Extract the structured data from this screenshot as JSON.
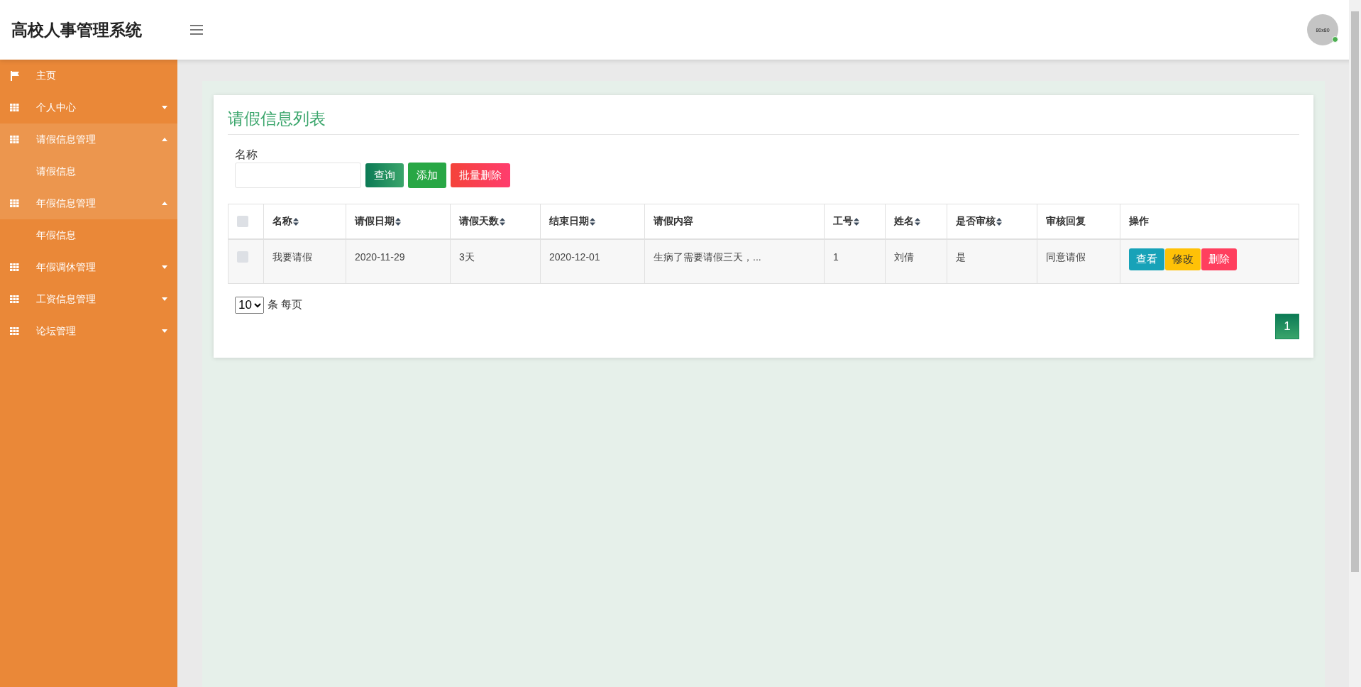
{
  "header": {
    "title": "高校人事管理系统",
    "avatar": "80x80"
  },
  "sidebar": {
    "items": [
      {
        "label": "主页",
        "kind": "link",
        "expanded": false
      },
      {
        "label": "个人中心",
        "kind": "group",
        "expanded": false
      },
      {
        "label": "请假信息管理",
        "kind": "group",
        "expanded": true,
        "children": [
          {
            "label": "请假信息",
            "selected": true
          }
        ]
      },
      {
        "label": "年假信息管理",
        "kind": "group",
        "expanded": true,
        "children": [
          {
            "label": "年假信息",
            "selected": false
          }
        ]
      },
      {
        "label": "年假调休管理",
        "kind": "group",
        "expanded": false
      },
      {
        "label": "工资信息管理",
        "kind": "group",
        "expanded": false
      },
      {
        "label": "论坛管理",
        "kind": "group",
        "expanded": false
      }
    ]
  },
  "card": {
    "title": "请假信息列表",
    "search": {
      "label": "名称"
    },
    "buttons": [
      {
        "label": "查询",
        "kind": "search"
      },
      {
        "label": "添加",
        "kind": "add"
      },
      {
        "label": "批量删除",
        "kind": "delete"
      }
    ],
    "table": {
      "select_all": {
        "checked": false
      },
      "columns": [
        {
          "label": "名称",
          "sortable": true
        },
        {
          "label": "请假日期",
          "sortable": true
        },
        {
          "label": "请假天数",
          "sortable": true
        },
        {
          "label": "结束日期",
          "sortable": true
        },
        {
          "label": "请假内容",
          "sortable": false
        },
        {
          "label": "工号",
          "sortable": true
        },
        {
          "label": "姓名",
          "sortable": true
        },
        {
          "label": "是否审核",
          "sortable": true
        },
        {
          "label": "审核回复",
          "sortable": false
        },
        {
          "label": "操作",
          "sortable": false
        }
      ],
      "rows": [
        {
          "checked": false,
          "cells": [
            "我要请假",
            "2020-11-29",
            "3天",
            "2020-12-01",
            "生病了需要请假三天，...",
            "1",
            "刘倩",
            "是",
            "同意请假"
          ],
          "actions": [
            {
              "label": "查看",
              "kind": "view"
            },
            {
              "label": "修改",
              "kind": "edit"
            },
            {
              "label": "删除",
              "kind": "delete"
            }
          ]
        }
      ]
    },
    "page_size": {
      "value": "10",
      "suffix": "条 每页"
    },
    "pages": [
      {
        "label": "1",
        "selected": true
      }
    ]
  }
}
